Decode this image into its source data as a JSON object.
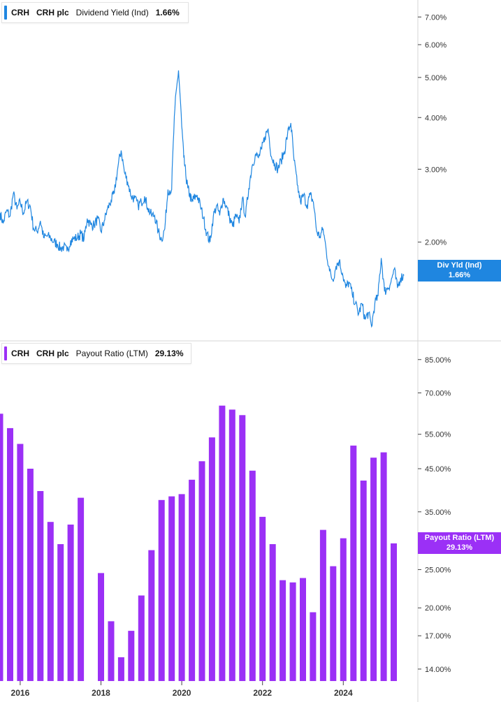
{
  "colors": {
    "yield_line": "#1f86e0",
    "bars": "#9b30f6",
    "axis": "#444444",
    "divider": "#d6d6d6"
  },
  "legend_top": {
    "ticker": "CRH",
    "name": "CRH plc",
    "metric": "Dividend Yield (Ind)",
    "value": "1.66%"
  },
  "legend_bottom": {
    "ticker": "CRH",
    "name": "CRH plc",
    "metric": "Payout Ratio (LTM)",
    "value": "29.13%"
  },
  "tag_top": {
    "label": "Div Yld (Ind)",
    "value": "1.66%"
  },
  "tag_bottom": {
    "label": "Payout Ratio (LTM)",
    "value": "29.13%"
  },
  "chart_data": [
    {
      "type": "line",
      "scale": "log",
      "ylim": [
        1.2,
        7.4
      ],
      "y_ticks": [
        7,
        6,
        5,
        4,
        3,
        2
      ],
      "y_tick_labels": [
        "7.00%",
        "6.00%",
        "5.00%",
        "4.00%",
        "3.00%",
        "2.00%"
      ],
      "x_range": [
        2015.5,
        2025.5
      ],
      "series": [
        {
          "name": "Div Yld (Ind)",
          "x": [
            2015.5,
            2015.58,
            2015.66,
            2015.75,
            2015.83,
            2015.92,
            2016.0,
            2016.08,
            2016.16,
            2016.25,
            2016.33,
            2016.42,
            2016.5,
            2016.58,
            2016.66,
            2016.75,
            2016.83,
            2016.92,
            2017.0,
            2017.08,
            2017.16,
            2017.25,
            2017.33,
            2017.42,
            2017.5,
            2017.58,
            2017.66,
            2017.75,
            2017.83,
            2017.92,
            2018.0,
            2018.08,
            2018.16,
            2018.25,
            2018.33,
            2018.42,
            2018.5,
            2018.58,
            2018.66,
            2018.75,
            2018.83,
            2018.92,
            2019.0,
            2019.08,
            2019.16,
            2019.25,
            2019.33,
            2019.42,
            2019.5,
            2019.58,
            2019.66,
            2019.75,
            2019.83,
            2019.92,
            2020.0,
            2020.05,
            2020.1,
            2020.15,
            2020.2,
            2020.25,
            2020.3,
            2020.38,
            2020.46,
            2020.54,
            2020.62,
            2020.7,
            2020.78,
            2020.86,
            2020.94,
            2021.02,
            2021.1,
            2021.18,
            2021.26,
            2021.34,
            2021.42,
            2021.5,
            2021.58,
            2021.66,
            2021.74,
            2021.82,
            2021.9,
            2021.98,
            2022.06,
            2022.14,
            2022.22,
            2022.3,
            2022.38,
            2022.46,
            2022.54,
            2022.62,
            2022.7,
            2022.78,
            2022.86,
            2022.94,
            2023.02,
            2023.1,
            2023.18,
            2023.26,
            2023.34,
            2023.42,
            2023.5,
            2023.58,
            2023.66,
            2023.74,
            2023.82,
            2023.9,
            2023.98,
            2024.06,
            2024.14,
            2024.22,
            2024.3,
            2024.38,
            2024.46,
            2024.54,
            2024.62,
            2024.7,
            2024.78,
            2024.86,
            2024.94,
            2025.02,
            2025.1,
            2025.18,
            2025.26,
            2025.34,
            2025.42,
            2025.5
          ],
          "y": [
            2.35,
            2.22,
            2.38,
            2.31,
            2.62,
            2.4,
            2.5,
            2.35,
            2.5,
            2.44,
            2.16,
            2.12,
            2.25,
            2.05,
            2.07,
            2.05,
            2.0,
            1.98,
            1.93,
            1.95,
            1.9,
            2.02,
            2.04,
            2.05,
            2.1,
            2.03,
            2.28,
            2.2,
            2.2,
            2.28,
            2.12,
            2.25,
            2.4,
            2.52,
            2.62,
            3.04,
            3.33,
            2.95,
            2.8,
            2.58,
            2.55,
            2.45,
            2.5,
            2.58,
            2.42,
            2.32,
            2.32,
            2.12,
            2.03,
            2.15,
            2.68,
            2.68,
            4.2,
            5.2,
            3.8,
            3.2,
            2.9,
            2.7,
            2.6,
            2.5,
            2.55,
            2.6,
            2.45,
            2.28,
            2.1,
            2.0,
            2.3,
            2.45,
            2.32,
            2.55,
            2.45,
            2.3,
            2.18,
            2.32,
            2.22,
            2.55,
            2.3,
            2.7,
            3.05,
            3.25,
            3.2,
            3.35,
            3.6,
            3.75,
            3.22,
            3.1,
            3.0,
            3.15,
            3.3,
            3.65,
            3.88,
            3.15,
            2.75,
            2.5,
            2.6,
            2.45,
            2.6,
            2.5,
            2.12,
            2.06,
            2.15,
            1.9,
            1.7,
            1.62,
            1.75,
            1.8,
            1.68,
            1.55,
            1.6,
            1.5,
            1.42,
            1.34,
            1.42,
            1.3,
            1.35,
            1.25,
            1.42,
            1.48,
            1.83,
            1.52,
            1.55,
            1.6,
            1.72,
            1.55,
            1.64,
            1.66
          ]
        }
      ]
    },
    {
      "type": "bar",
      "scale": "log",
      "ylim": [
        13.6,
        91
      ],
      "y_ticks": [
        85,
        70,
        55,
        45,
        35,
        25,
        20,
        17,
        14
      ],
      "y_tick_labels": [
        "85.00%",
        "70.00%",
        "55.00%",
        "45.00%",
        "35.00%",
        "25.00%",
        "20.00%",
        "17.00%",
        "14.00%"
      ],
      "x_range": [
        2015.5,
        2025.5
      ],
      "x_ticks": [
        2016,
        2018,
        2020,
        2022,
        2024
      ],
      "x_tick_labels": [
        "2016",
        "2018",
        "2020",
        "2022",
        "2024"
      ],
      "series": [
        {
          "name": "Payout Ratio (LTM)",
          "x": [
            2015.5,
            2015.75,
            2016.0,
            2016.25,
            2016.5,
            2016.75,
            2017.0,
            2017.25,
            2017.5,
            2018.0,
            2018.25,
            2018.5,
            2018.75,
            2019.0,
            2019.25,
            2019.5,
            2019.75,
            2020.0,
            2020.25,
            2020.5,
            2020.75,
            2021.0,
            2021.25,
            2021.5,
            2021.75,
            2022.0,
            2022.25,
            2022.5,
            2022.75,
            2023.0,
            2023.25,
            2023.5,
            2023.75,
            2024.0,
            2024.25,
            2024.5,
            2024.75,
            2025.0,
            2025.25
          ],
          "values": [
            62,
            57,
            52,
            45,
            39.5,
            33,
            29,
            32.5,
            38,
            24.5,
            18.5,
            15,
            17.5,
            21.5,
            28,
            37.5,
            38.3,
            38.8,
            42.2,
            47,
            54,
            65,
            63.5,
            61.5,
            44.5,
            34,
            29,
            23.5,
            23.2,
            23.8,
            19.5,
            31.5,
            25.5,
            30,
            51.5,
            42,
            48,
            49.5,
            29.13
          ]
        }
      ]
    }
  ]
}
